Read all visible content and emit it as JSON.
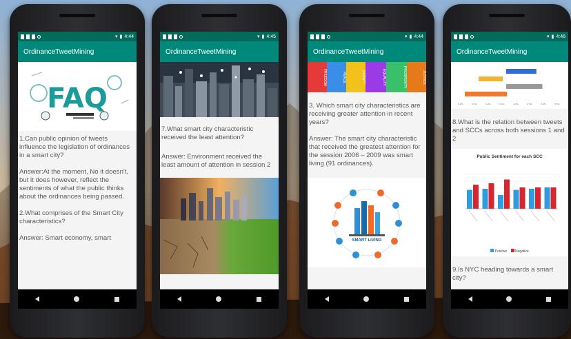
{
  "app_title": "OrdinanceTweetMining",
  "phones": [
    {
      "time": "4:44",
      "q1": "1.Can public opinion of tweets influence the legislation of ordinances in a smart city?",
      "a1": "Answer:At the moment, No it doesn't, but it does however, reflect the sentiments of what the public thinks about the ordinances being passed.",
      "q2": "2.What comprises of the Smart City characteristics?",
      "a2": "Answer: Smart economy, smart"
    },
    {
      "time": "4:45",
      "q": "7.What smart city characteristic received the least attention?",
      "a": "Answer: Environment received the least amount of attention in session 2"
    },
    {
      "time": "4:44",
      "banner_words": [
        "FREEDOM",
        "PEACE",
        "DIGNITY",
        "EQUALITY",
        "PROSPERITY",
        "JUSTICE"
      ],
      "q": "3. Which smart city characteristics are receiving greater attention in recent years?",
      "a": "Answer: The smart city characteristic that received the greatest attention for the session 2006 – 2009 was smart living (91 ordinances).",
      "diagram_label": "SMART LIVING"
    },
    {
      "time": "4:46",
      "q8": "8.What is the relation between tweets and SCCs across both sessions 1 and 2",
      "chart_title": "Public Sentiment for each SCC",
      "legend_pos": "Positive",
      "legend_neg": "Negative",
      "q9": "9.Is NYC heading towards a smart city?"
    }
  ],
  "faq_text": "FAQ",
  "colors": {
    "statusbar": "#046a5b",
    "appbar": "#00897b",
    "positive": "#2f9be0",
    "negative": "#d8262f"
  },
  "chart_data": [
    {
      "type": "bar",
      "title": "",
      "note": "top chart partially visible, horizontal bars",
      "categories": [
        "",
        "",
        "",
        ""
      ],
      "values": [
        0.025,
        0.02,
        0.03,
        0.035
      ],
      "xlabel": "",
      "ylabel": ""
    },
    {
      "type": "bar",
      "title": "Public Sentiment for each SCC",
      "categories": [
        "",
        "",
        "",
        "",
        "",
        ""
      ],
      "series": [
        {
          "name": "Positive",
          "values": [
            0.55,
            0.58,
            0.4,
            0.55,
            0.58,
            0.62
          ]
        },
        {
          "name": "Negative",
          "values": [
            0.7,
            0.74,
            0.85,
            0.62,
            0.62,
            0.62
          ]
        }
      ],
      "ylim": [
        0,
        1
      ]
    }
  ]
}
